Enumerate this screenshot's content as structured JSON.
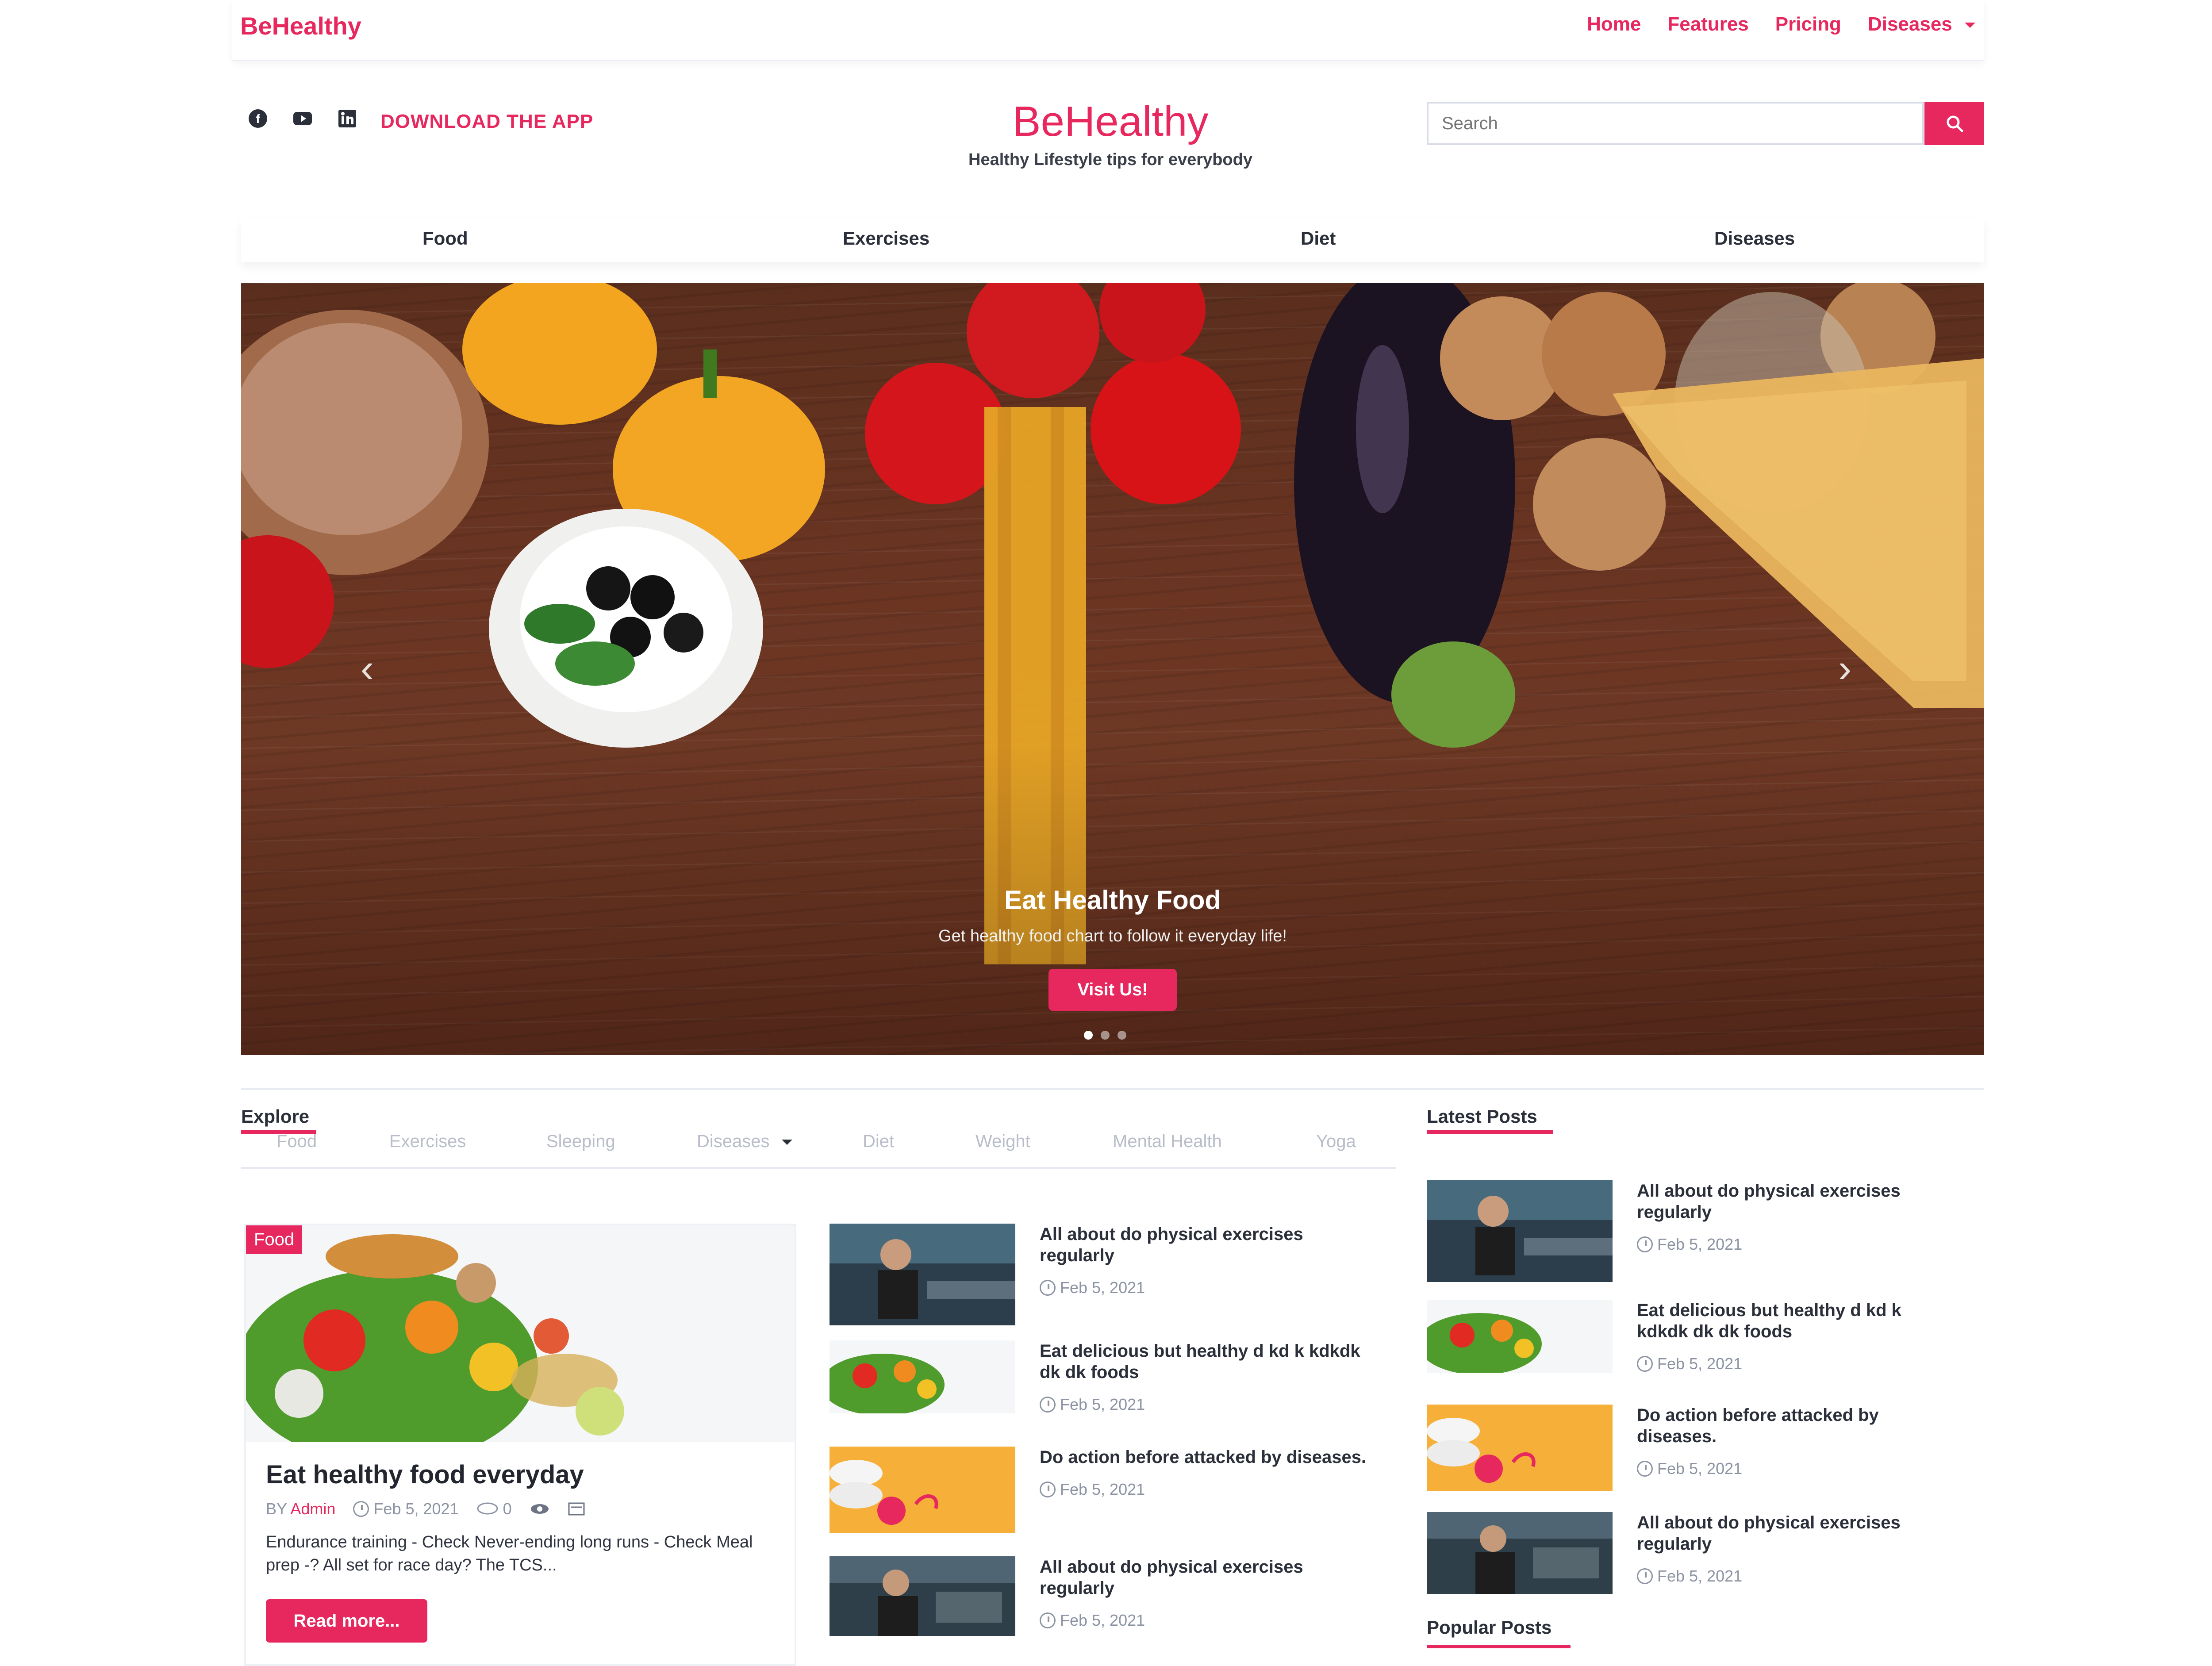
{
  "topbar": {
    "brand": "BeHealthy",
    "nav": [
      "Home",
      "Features",
      "Pricing",
      "Diseases"
    ]
  },
  "header": {
    "download_label": "DOWNLOAD THE APP",
    "site_title": "BeHealthy",
    "tagline": "Healthy Lifestyle tips for everybody",
    "search_placeholder": "Search",
    "social_icons": [
      "facebook-icon",
      "youtube-icon",
      "linkedin-icon"
    ]
  },
  "categories": [
    "Food",
    "Exercises",
    "Diet",
    "Diseases"
  ],
  "hero": {
    "title": "Eat Healthy Food",
    "subtitle": "Get healthy food chart to follow it everyday life!",
    "button_label": "Visit Us!",
    "slides_count": 3,
    "active_slide": 0
  },
  "explore": {
    "title": "Explore",
    "tabs": [
      "Food",
      "Exercises",
      "Sleeping",
      "Diseases",
      "Diet",
      "Weight",
      "Mental Health",
      "Yoga"
    ]
  },
  "feature_card": {
    "badge": "Food",
    "title": "Eat healthy food everyday",
    "author_prefix": "BY",
    "author": "Admin",
    "date": "Feb 5, 2021",
    "comments": "0",
    "excerpt": "Endurance training - Check Never-ending long runs - Check Meal prep -? All set for race day? The TCS...",
    "button_label": "Read more..."
  },
  "middle_posts": [
    {
      "title": "All about do physical exercises regularly",
      "date": "Feb 5, 2021",
      "thumb": "gym"
    },
    {
      "title": "Eat delicious but healthy d kd k kdkdk dk dk foods",
      "date": "Feb 5, 2021",
      "thumb": "veggies"
    },
    {
      "title": "Do action before attacked by diseases.",
      "date": "Feb 5, 2021",
      "thumb": "pills"
    },
    {
      "title": "All about do physical exercises regularly",
      "date": "Feb 5, 2021",
      "thumb": "gym2"
    }
  ],
  "latest": {
    "title": "Latest Posts",
    "posts": [
      {
        "title": "All about do physical exercises regularly",
        "date": "Feb 5, 2021",
        "thumb": "gym"
      },
      {
        "title": "Eat delicious but healthy d kd k kdkdk dk dk foods",
        "date": "Feb 5, 2021",
        "thumb": "veggies"
      },
      {
        "title": "Do action before attacked by diseases.",
        "date": "Feb 5, 2021",
        "thumb": "pills"
      },
      {
        "title": "All about do physical exercises regularly",
        "date": "Feb 5, 2021",
        "thumb": "gym2"
      }
    ]
  },
  "popular": {
    "title": "Popular Posts"
  },
  "colors": {
    "accent": "#e6285f",
    "text": "#2a2f3a",
    "muted": "#8c93a3"
  }
}
